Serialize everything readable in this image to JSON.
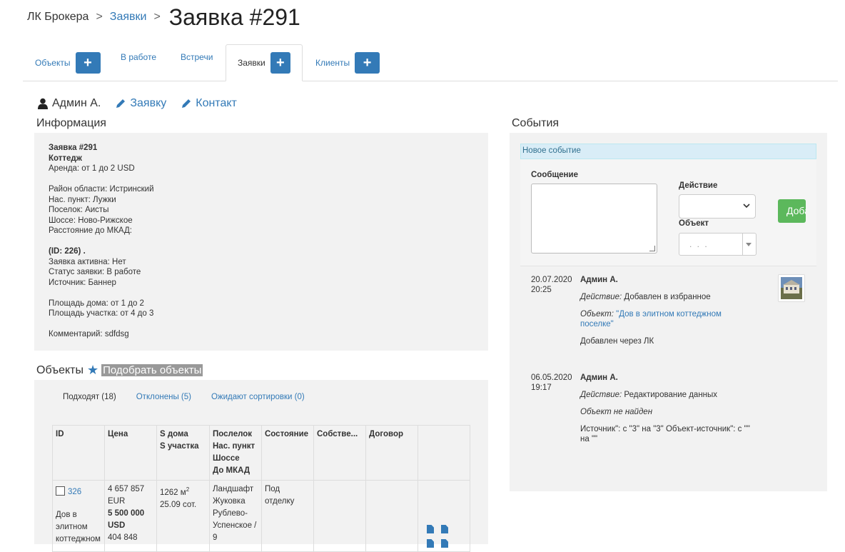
{
  "breadcrumb": {
    "home": "ЛК Брокера",
    "section": "Заявки",
    "title": "Заявка #291",
    "separator": ">"
  },
  "tabs": [
    {
      "label": "Объекты",
      "has_add": true,
      "active": false
    },
    {
      "label": "В работе",
      "has_add": false,
      "active": false
    },
    {
      "label": "Встречи",
      "has_add": false,
      "active": false
    },
    {
      "label": "Заявки",
      "has_add": true,
      "active": true
    },
    {
      "label": "Клиенты",
      "has_add": true,
      "active": false
    }
  ],
  "add_symbol": "+",
  "userline": {
    "user": "Админ А.",
    "edit_request": "Заявку",
    "edit_contact": "Контакт"
  },
  "info": {
    "heading": "Информация",
    "lines": [
      {
        "text": "Заявка #291",
        "bold": true
      },
      {
        "text": "Коттедж",
        "bold": true
      },
      {
        "text": "Аренда: от 1 до 2 USD"
      },
      {
        "gap": true
      },
      {
        "text": "Район области: Истринский"
      },
      {
        "text": "Нас. пункт: Лужки"
      },
      {
        "text": "Поселок: Аисты"
      },
      {
        "text": "Шоссе: Ново-Рижское"
      },
      {
        "text": "Расстояние до МКАД:"
      },
      {
        "gap": true
      },
      {
        "text": "(ID: 226) .",
        "bold": true
      },
      {
        "text": "Заявка активна: Нет"
      },
      {
        "text": "Статус заявки: В работе"
      },
      {
        "text": "Источник: Баннер"
      },
      {
        "gap": true
      },
      {
        "text": "Площадь дома: от 1 до 2"
      },
      {
        "text": "Площадь участка: от 4 до 3"
      },
      {
        "gap": true
      },
      {
        "text": "Комментарий: sdfdsg"
      }
    ]
  },
  "objects": {
    "heading": "Объекты",
    "pick_button": "Подобрать объекты",
    "subtabs": [
      {
        "label": "Подходят (18)",
        "active": true
      },
      {
        "label": "Отклонены (5)",
        "active": false
      },
      {
        "label": "Ожидают сортировки (0)",
        "active": false
      }
    ],
    "columns": [
      {
        "lines": [
          "ID"
        ]
      },
      {
        "lines": [
          "Цена"
        ]
      },
      {
        "lines": [
          "S дома",
          "S участка"
        ]
      },
      {
        "lines": [
          "Послелок",
          "Нас. пункт",
          "Шоссе",
          "До МКАД"
        ]
      },
      {
        "lines": [
          "Состояние"
        ]
      },
      {
        "lines": [
          "Собстве..."
        ]
      },
      {
        "lines": [
          "Договор"
        ]
      },
      {
        "lines": [
          ""
        ]
      }
    ],
    "rows": [
      {
        "id": "326",
        "name": "Дов в элитном коттеджном",
        "price": [
          "4 657 857",
          "EUR"
        ],
        "price_bold": [
          "5 500 000",
          "USD"
        ],
        "price_extra": "404 848",
        "house_area": "1262 м",
        "area_sup": "2",
        "plot_area": "25.09 сот.",
        "location": [
          "Ландшафт",
          "Жуковка",
          "Рублево-",
          "Успенское /",
          "9"
        ],
        "state": [
          "Под",
          "отделку"
        ],
        "owner": "",
        "contract": ""
      }
    ]
  },
  "events": {
    "heading": "События",
    "new_event": "Новое событие",
    "message_label": "Сообщение",
    "action_label": "Действие",
    "object_label": "Объект",
    "object_placeholder": ". . .",
    "add_button": "Добавить",
    "items": [
      {
        "date": "20.07.2020",
        "time": "20:25",
        "user": "Админ А.",
        "action_label": "Действие:",
        "action": "Добавлен в избранное",
        "object_label": "Объект:",
        "object_link": "\"Дов в элитном коттеджном поселке\"",
        "note": "Добавлен через ЛК"
      },
      {
        "date": "06.05.2020",
        "time": "19:17",
        "user": "Админ А.",
        "action_label": "Действие:",
        "action": "Редактирование данных",
        "object_missing": "Объект не найден",
        "note": "Источник\": с \"3\" на \"3\" Объект-источник\": с \"\" на \"\""
      }
    ]
  },
  "colors": {
    "link": "#337ab7",
    "primary_button": "#337ab7",
    "success_button": "#5cb85c",
    "panel_bg": "#f2f2f2",
    "info_header_bg": "#d9edf7"
  }
}
